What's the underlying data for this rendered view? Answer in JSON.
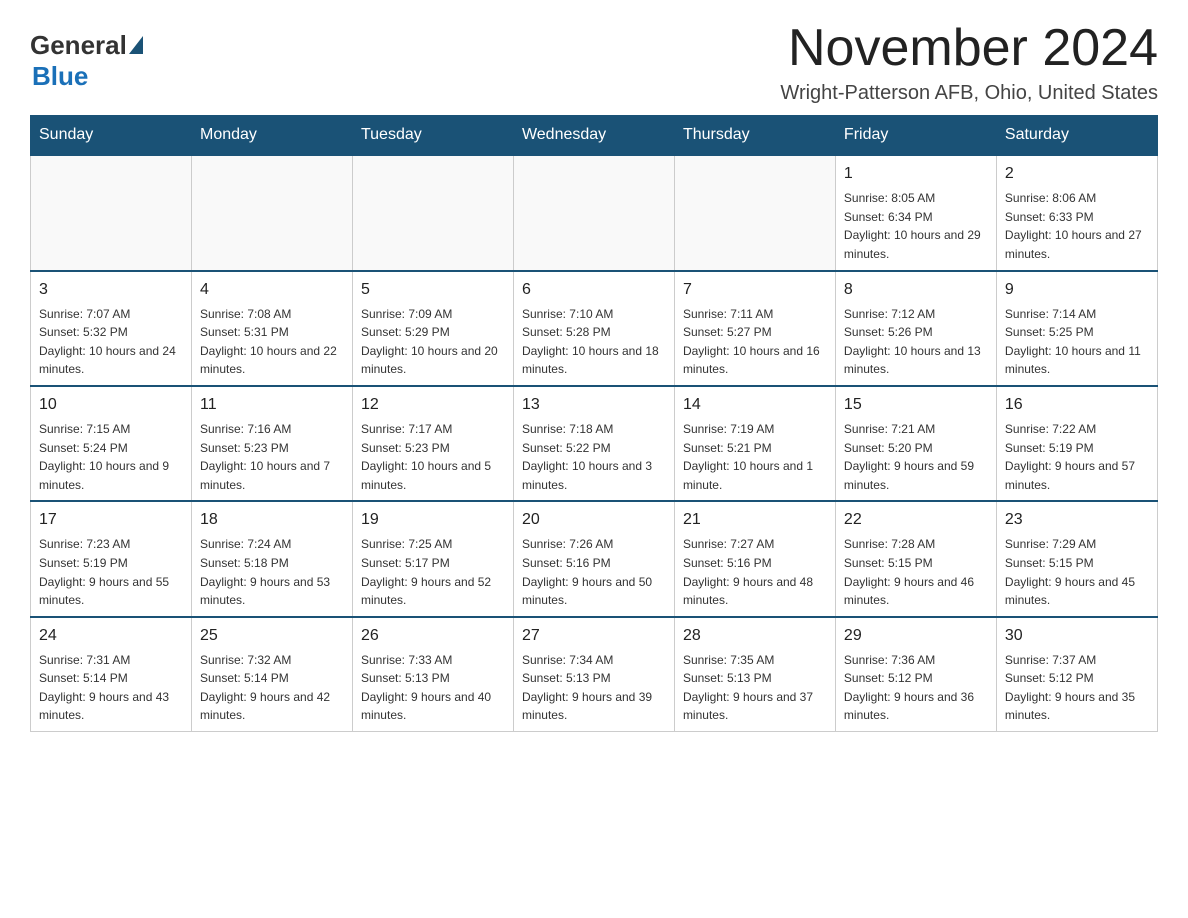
{
  "header": {
    "logo": {
      "general": "General",
      "blue": "Blue"
    },
    "title": "November 2024",
    "subtitle": "Wright-Patterson AFB, Ohio, United States"
  },
  "calendar": {
    "days_of_week": [
      "Sunday",
      "Monday",
      "Tuesday",
      "Wednesday",
      "Thursday",
      "Friday",
      "Saturday"
    ],
    "weeks": [
      [
        {
          "day": "",
          "info": ""
        },
        {
          "day": "",
          "info": ""
        },
        {
          "day": "",
          "info": ""
        },
        {
          "day": "",
          "info": ""
        },
        {
          "day": "",
          "info": ""
        },
        {
          "day": "1",
          "info": "Sunrise: 8:05 AM\nSunset: 6:34 PM\nDaylight: 10 hours and 29 minutes."
        },
        {
          "day": "2",
          "info": "Sunrise: 8:06 AM\nSunset: 6:33 PM\nDaylight: 10 hours and 27 minutes."
        }
      ],
      [
        {
          "day": "3",
          "info": "Sunrise: 7:07 AM\nSunset: 5:32 PM\nDaylight: 10 hours and 24 minutes."
        },
        {
          "day": "4",
          "info": "Sunrise: 7:08 AM\nSunset: 5:31 PM\nDaylight: 10 hours and 22 minutes."
        },
        {
          "day": "5",
          "info": "Sunrise: 7:09 AM\nSunset: 5:29 PM\nDaylight: 10 hours and 20 minutes."
        },
        {
          "day": "6",
          "info": "Sunrise: 7:10 AM\nSunset: 5:28 PM\nDaylight: 10 hours and 18 minutes."
        },
        {
          "day": "7",
          "info": "Sunrise: 7:11 AM\nSunset: 5:27 PM\nDaylight: 10 hours and 16 minutes."
        },
        {
          "day": "8",
          "info": "Sunrise: 7:12 AM\nSunset: 5:26 PM\nDaylight: 10 hours and 13 minutes."
        },
        {
          "day": "9",
          "info": "Sunrise: 7:14 AM\nSunset: 5:25 PM\nDaylight: 10 hours and 11 minutes."
        }
      ],
      [
        {
          "day": "10",
          "info": "Sunrise: 7:15 AM\nSunset: 5:24 PM\nDaylight: 10 hours and 9 minutes."
        },
        {
          "day": "11",
          "info": "Sunrise: 7:16 AM\nSunset: 5:23 PM\nDaylight: 10 hours and 7 minutes."
        },
        {
          "day": "12",
          "info": "Sunrise: 7:17 AM\nSunset: 5:23 PM\nDaylight: 10 hours and 5 minutes."
        },
        {
          "day": "13",
          "info": "Sunrise: 7:18 AM\nSunset: 5:22 PM\nDaylight: 10 hours and 3 minutes."
        },
        {
          "day": "14",
          "info": "Sunrise: 7:19 AM\nSunset: 5:21 PM\nDaylight: 10 hours and 1 minute."
        },
        {
          "day": "15",
          "info": "Sunrise: 7:21 AM\nSunset: 5:20 PM\nDaylight: 9 hours and 59 minutes."
        },
        {
          "day": "16",
          "info": "Sunrise: 7:22 AM\nSunset: 5:19 PM\nDaylight: 9 hours and 57 minutes."
        }
      ],
      [
        {
          "day": "17",
          "info": "Sunrise: 7:23 AM\nSunset: 5:19 PM\nDaylight: 9 hours and 55 minutes."
        },
        {
          "day": "18",
          "info": "Sunrise: 7:24 AM\nSunset: 5:18 PM\nDaylight: 9 hours and 53 minutes."
        },
        {
          "day": "19",
          "info": "Sunrise: 7:25 AM\nSunset: 5:17 PM\nDaylight: 9 hours and 52 minutes."
        },
        {
          "day": "20",
          "info": "Sunrise: 7:26 AM\nSunset: 5:16 PM\nDaylight: 9 hours and 50 minutes."
        },
        {
          "day": "21",
          "info": "Sunrise: 7:27 AM\nSunset: 5:16 PM\nDaylight: 9 hours and 48 minutes."
        },
        {
          "day": "22",
          "info": "Sunrise: 7:28 AM\nSunset: 5:15 PM\nDaylight: 9 hours and 46 minutes."
        },
        {
          "day": "23",
          "info": "Sunrise: 7:29 AM\nSunset: 5:15 PM\nDaylight: 9 hours and 45 minutes."
        }
      ],
      [
        {
          "day": "24",
          "info": "Sunrise: 7:31 AM\nSunset: 5:14 PM\nDaylight: 9 hours and 43 minutes."
        },
        {
          "day": "25",
          "info": "Sunrise: 7:32 AM\nSunset: 5:14 PM\nDaylight: 9 hours and 42 minutes."
        },
        {
          "day": "26",
          "info": "Sunrise: 7:33 AM\nSunset: 5:13 PM\nDaylight: 9 hours and 40 minutes."
        },
        {
          "day": "27",
          "info": "Sunrise: 7:34 AM\nSunset: 5:13 PM\nDaylight: 9 hours and 39 minutes."
        },
        {
          "day": "28",
          "info": "Sunrise: 7:35 AM\nSunset: 5:13 PM\nDaylight: 9 hours and 37 minutes."
        },
        {
          "day": "29",
          "info": "Sunrise: 7:36 AM\nSunset: 5:12 PM\nDaylight: 9 hours and 36 minutes."
        },
        {
          "day": "30",
          "info": "Sunrise: 7:37 AM\nSunset: 5:12 PM\nDaylight: 9 hours and 35 minutes."
        }
      ]
    ]
  }
}
